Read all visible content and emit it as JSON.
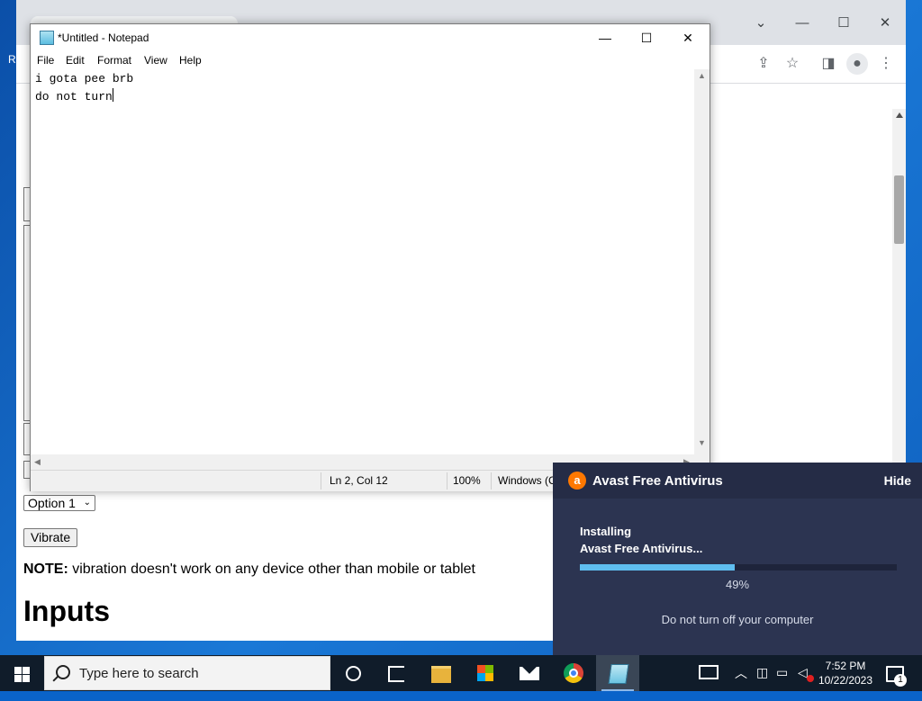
{
  "desktop": {
    "edge_letter": "R"
  },
  "browser": {
    "window_controls": {
      "minimize": "—",
      "restore": "☐",
      "close": "✕",
      "tabs_menu": "⌄"
    },
    "toolbar_icons": [
      "share-icon",
      "star-icon",
      "sidebar-icon",
      "profile-icon",
      "more-icon"
    ],
    "page": {
      "select_value": "Option 1",
      "vibrate_button": "Vibrate",
      "note_label": "NOTE:",
      "note_text": " vibration doesn't work on any device other than mobile or tablet",
      "heading": "Inputs"
    }
  },
  "notepad": {
    "title": "*Untitled - Notepad",
    "menu": [
      "File",
      "Edit",
      "Format",
      "View",
      "Help"
    ],
    "lines": [
      "i gota pee brb",
      "do not turn"
    ],
    "status": {
      "position": "Ln 2, Col 12",
      "zoom": "100%",
      "encoding": "Windows (C"
    },
    "controls": {
      "minimize": "—",
      "maximize": "☐",
      "close": "✕"
    }
  },
  "avast": {
    "title": "Avast Free Antivirus",
    "hide": "Hide",
    "installing_line1": "Installing",
    "installing_line2": "Avast Free Antivirus...",
    "progress": 0.49,
    "progress_label": "49%",
    "note": "Do not turn off your computer",
    "colors": {
      "panel": "#2c3451",
      "accent": "#ff7800",
      "progress": "#5fbef0"
    }
  },
  "taskbar": {
    "search_placeholder": "Type here to search",
    "pinned": [
      "cortana-icon",
      "task-view-icon",
      "file-explorer-icon",
      "store-icon",
      "mail-icon",
      "chrome-icon",
      "notepad-icon"
    ],
    "time": "7:52 PM",
    "date": "10/22/2023",
    "notification_count": "1"
  }
}
